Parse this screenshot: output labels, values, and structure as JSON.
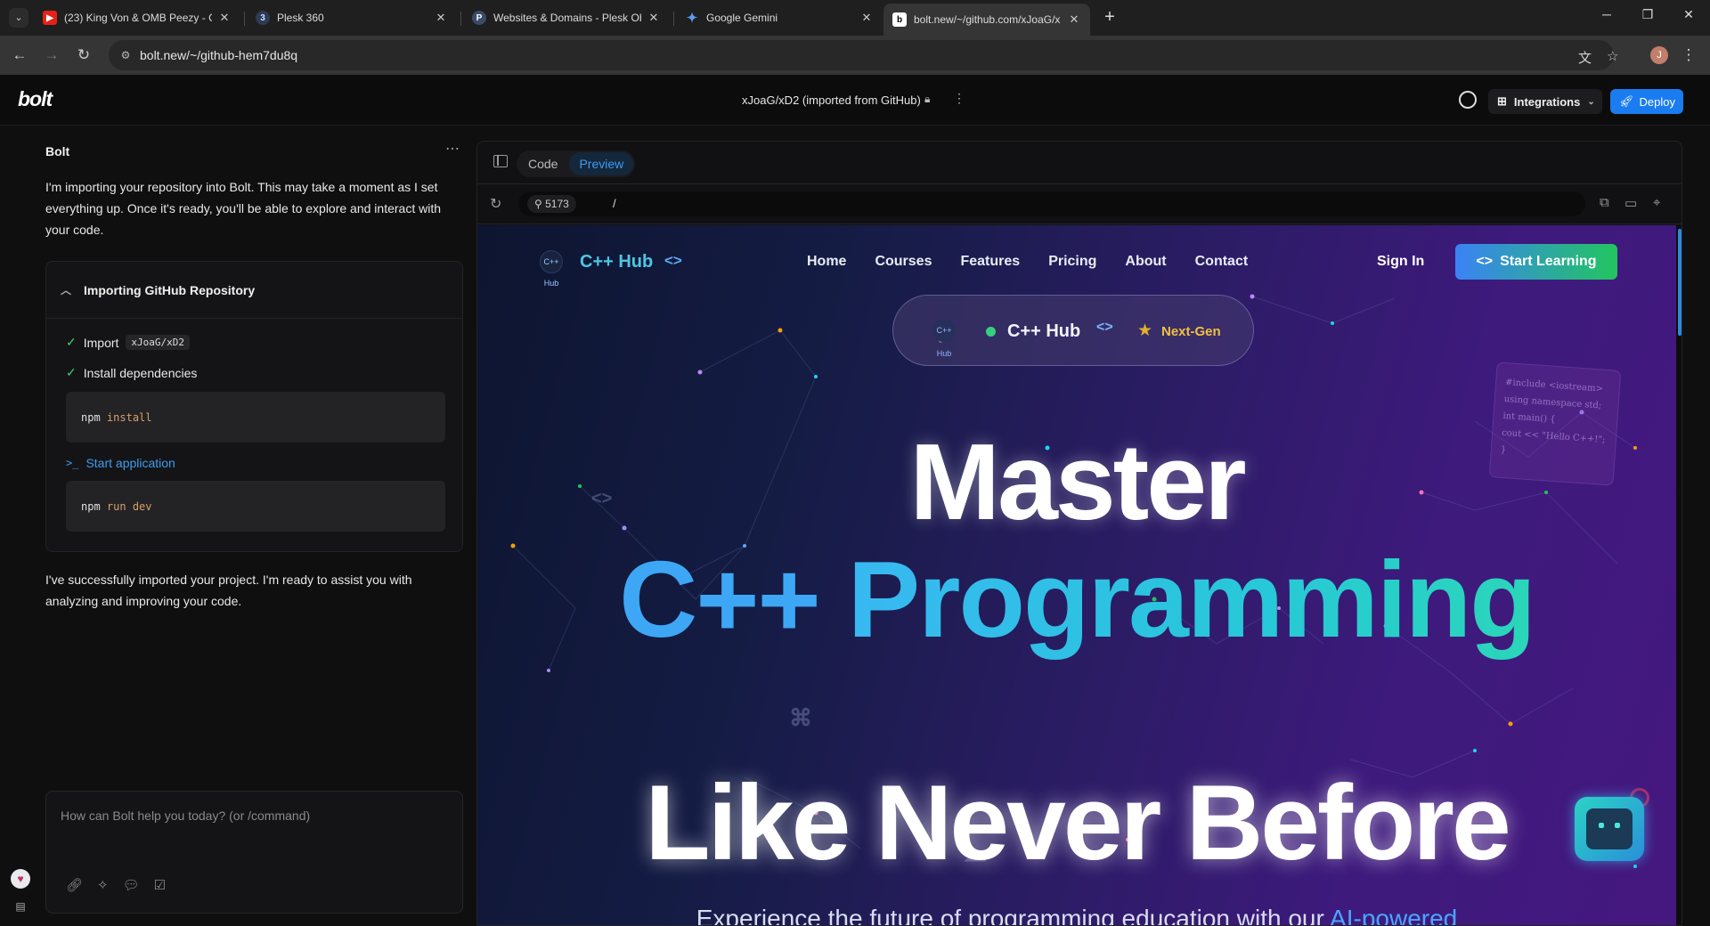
{
  "browser": {
    "tabs": [
      {
        "title": "(23) King Von & OMB Peezy - G",
        "icon": "youtube-icon"
      },
      {
        "title": "Plesk 360",
        "icon": "plesk-360-icon"
      },
      {
        "title": "Websites & Domains - Plesk Ob",
        "icon": "plesk-icon"
      },
      {
        "title": "Google Gemini",
        "icon": "gemini-icon"
      },
      {
        "title": "bolt.new/~/github.com/xJoaG/x",
        "icon": "bolt-icon"
      }
    ],
    "url": "bolt.new/~/github-hem7du8q",
    "profile_initial": "J"
  },
  "app": {
    "logo": "bolt",
    "project_title": "xJoaG/xD2 (imported from GitHub)",
    "integrations_label": "Integrations",
    "deploy_label": "Deploy"
  },
  "chat": {
    "title": "Bolt",
    "intro": "I'm importing your repository into Bolt. This may take a moment as I set everything up. Once it's ready, you'll be able to explore and interact with your code.",
    "card": {
      "title": "Importing GitHub Repository",
      "step_import": "Import",
      "repo_pill": "xJoaG/xD2",
      "step_install": "Install dependencies",
      "cmd_install": {
        "bin": "npm",
        "arg": "install"
      },
      "step_start": "Start application",
      "cmd_start": {
        "bin": "npm",
        "arg": "run dev"
      }
    },
    "outro": "I've successfully imported your project. I'm ready to assist you with analyzing and improving your code.",
    "input_placeholder": "How can Bolt help you today? (or /command)"
  },
  "workbench": {
    "tabs": [
      "Code",
      "Preview"
    ],
    "active_tab": "Preview",
    "port": "5173",
    "path": "/"
  },
  "preview": {
    "brand": "C++ Hub",
    "logo_text": "C++ Hub",
    "nav": [
      "Home",
      "Courses",
      "Features",
      "Pricing",
      "About",
      "Contact"
    ],
    "sign_in": "Sign In",
    "cta": "Start Learning",
    "badge_name": "C++ Hub",
    "badge_tag": "Next-Gen",
    "headline_1": "Master",
    "headline_2a": "C++",
    "headline_2b": "Programming",
    "headline_3": "Like Never Before",
    "subline_a": "Experience the future of programming education with our",
    "subline_b": "AI-powered",
    "code_card": [
      "#include <iostream>",
      "using namespace std;",
      "int main() {",
      "cout << \"Hello C++!\";",
      "}"
    ],
    "colors": {
      "accent_blue": "#3da7f5",
      "accent_teal": "#2ad6b8",
      "cta_green": "#22c55e",
      "star": "#e0b030"
    }
  }
}
